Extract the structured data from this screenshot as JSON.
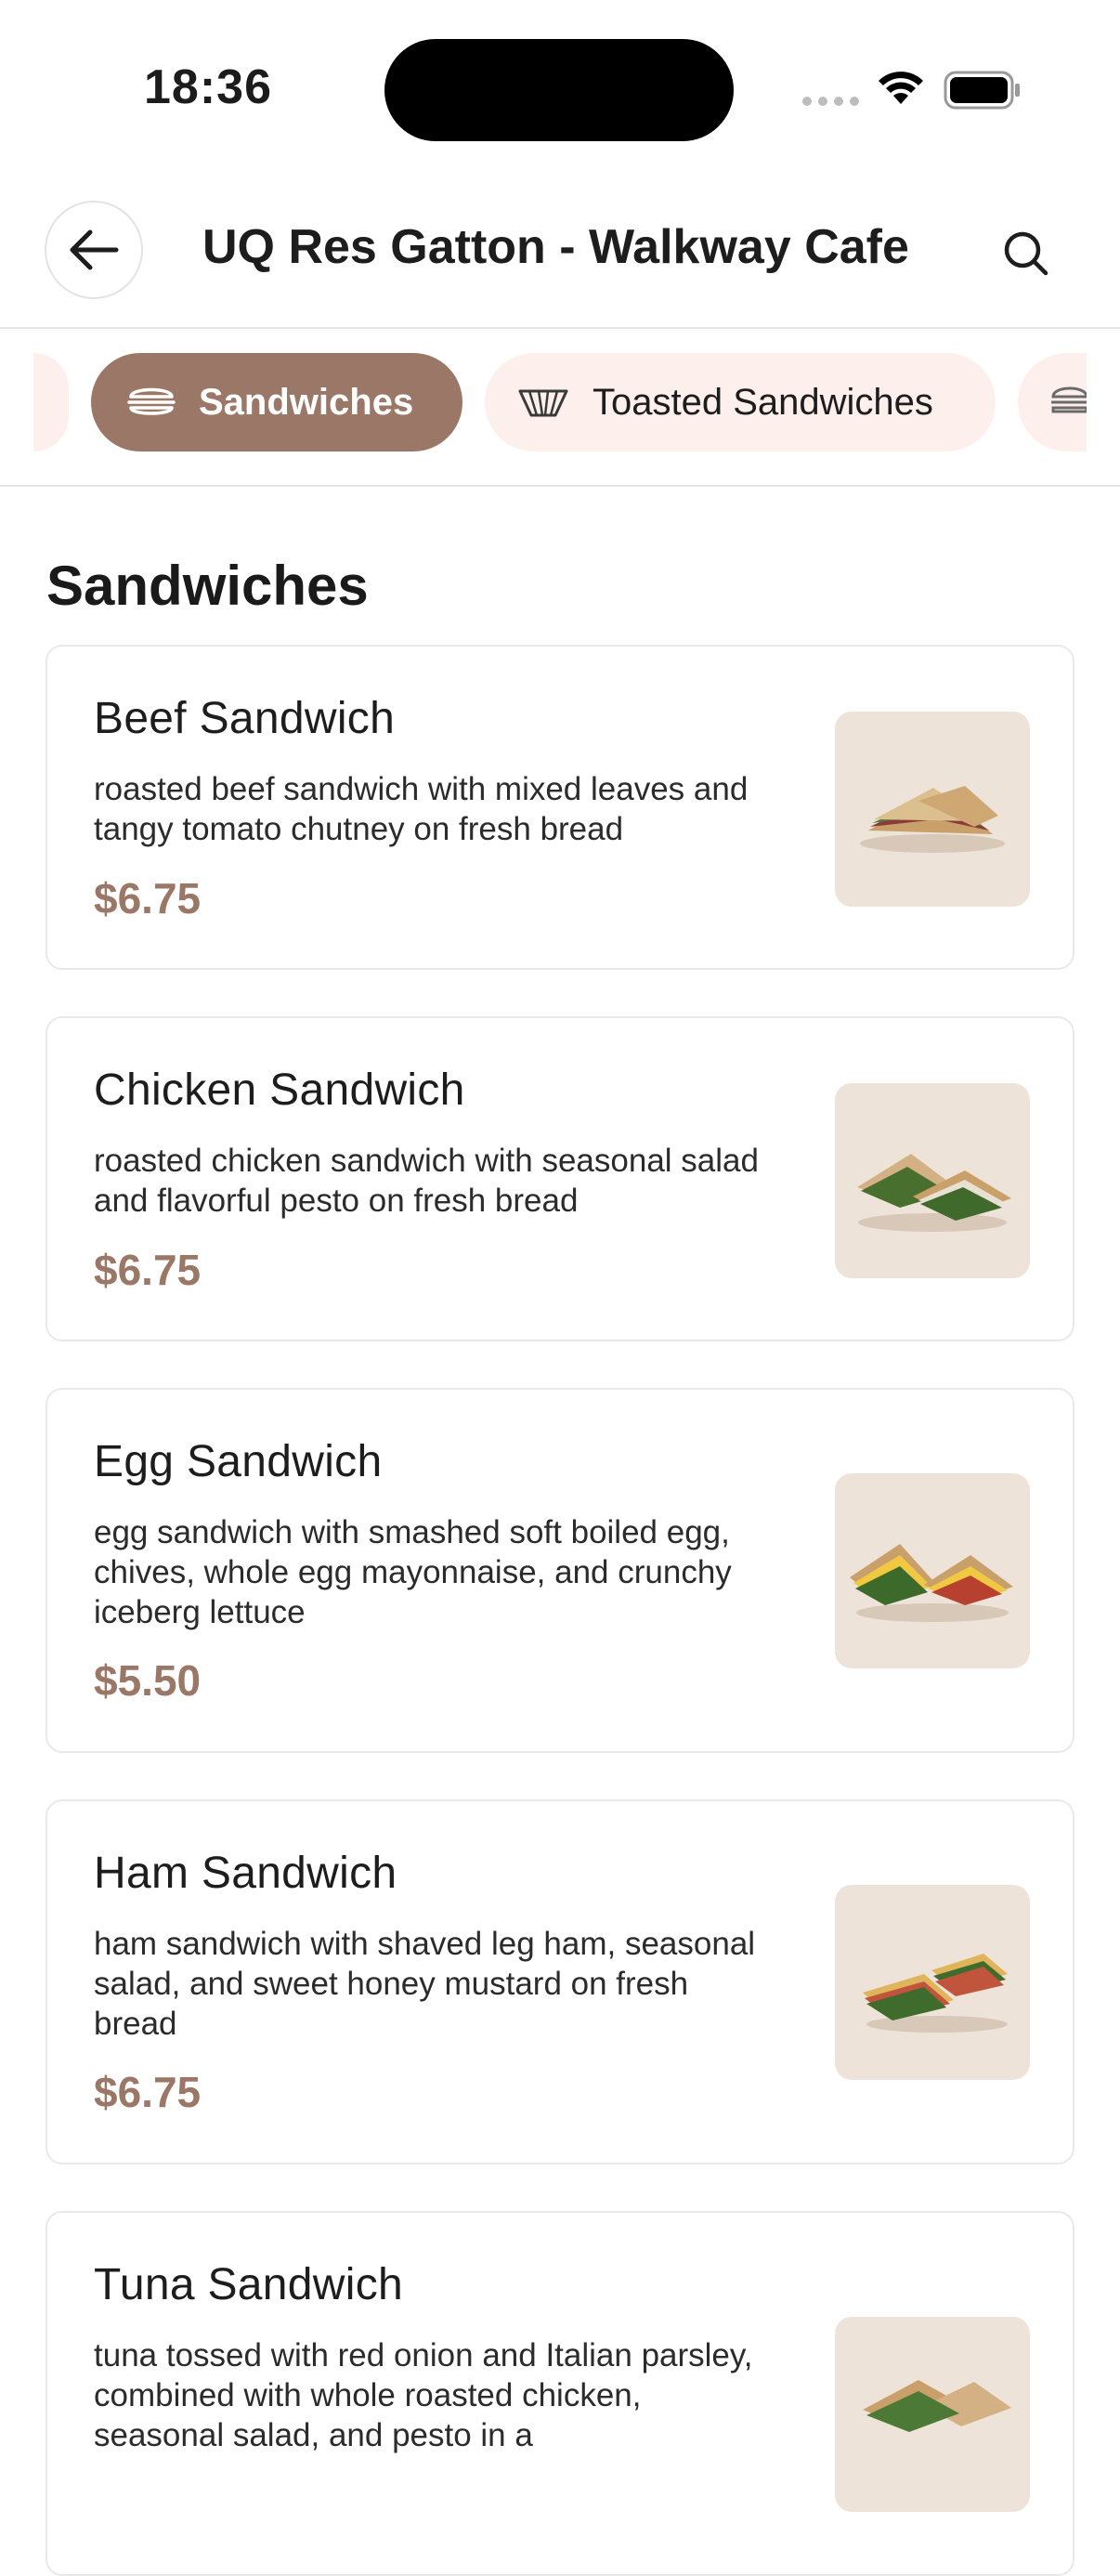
{
  "status_bar": {
    "time": "18:36"
  },
  "header": {
    "title": "UQ Res Gatton - Walkway Cafe"
  },
  "categories": [
    {
      "label": "Sandwiches",
      "active": true,
      "icon": "sandwich-icon"
    },
    {
      "label": "Toasted Sandwiches",
      "active": false,
      "icon": "toasted-sandwich-icon"
    }
  ],
  "section": {
    "title": "Sandwiches"
  },
  "items": [
    {
      "name": "Beef Sandwich",
      "description": "roasted beef sandwich with mixed leaves and tangy tomato chutney on fresh bread",
      "price": "$6.75"
    },
    {
      "name": "Chicken Sandwich",
      "description": "roasted chicken sandwich with seasonal salad and flavorful pesto on fresh bread",
      "price": "$6.75"
    },
    {
      "name": "Egg Sandwich",
      "description": "egg sandwich with smashed soft boiled egg, chives, whole egg mayonnaise, and crunchy iceberg lettuce",
      "price": "$5.50"
    },
    {
      "name": "Ham Sandwich",
      "description": "ham sandwich with shaved leg ham, seasonal salad, and sweet honey mustard on fresh bread",
      "price": "$6.75"
    },
    {
      "name": "Tuna Sandwich",
      "description": "tuna tossed with red onion and Italian parsley, combined with whole roasted chicken, seasonal salad, and pesto in a",
      "price": ""
    }
  ],
  "colors": {
    "accent": "#9a7766",
    "chip_bg": "#fdf0ec",
    "image_bg": "#ede3d9"
  }
}
